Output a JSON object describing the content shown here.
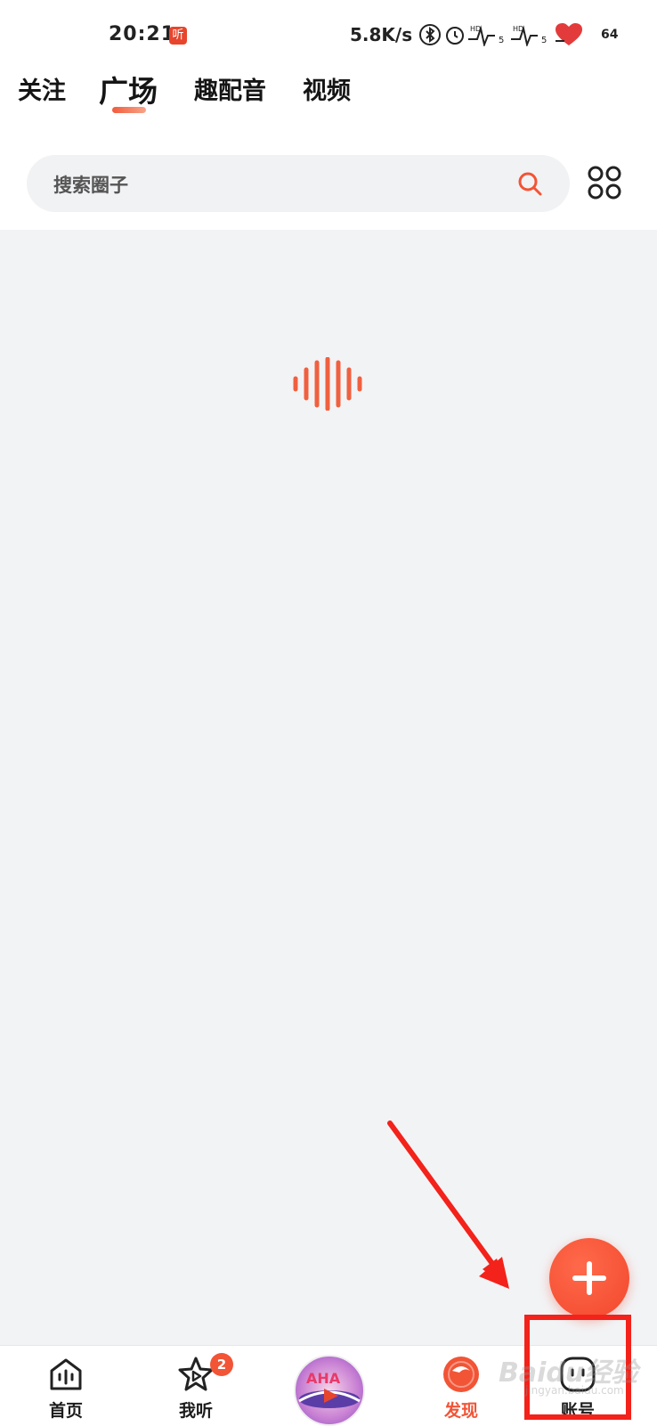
{
  "status_bar": {
    "time": "20:21",
    "app_badge": "听",
    "net_speed": "5.8K/s",
    "battery": "64"
  },
  "tabs": [
    {
      "label": "关注"
    },
    {
      "label": "广场"
    },
    {
      "label": "趣配音"
    },
    {
      "label": "视频"
    }
  ],
  "active_tab": "广场",
  "search": {
    "placeholder": "搜索圈子"
  },
  "bottom_nav": {
    "items": [
      {
        "label": "首页",
        "icon": "home-icon"
      },
      {
        "label": "我听",
        "icon": "play-star-icon",
        "badge": "2"
      },
      {
        "label": "",
        "icon": "center-planet-icon"
      },
      {
        "label": "发现",
        "icon": "discover-icon",
        "active": true
      },
      {
        "label": "账号",
        "icon": "account-icon"
      }
    ]
  },
  "watermark": {
    "text": "Baidu经验",
    "sub": "jingyan.baidu.com"
  },
  "colors": {
    "accent": "#f25436",
    "annotation": "#f3221a"
  }
}
